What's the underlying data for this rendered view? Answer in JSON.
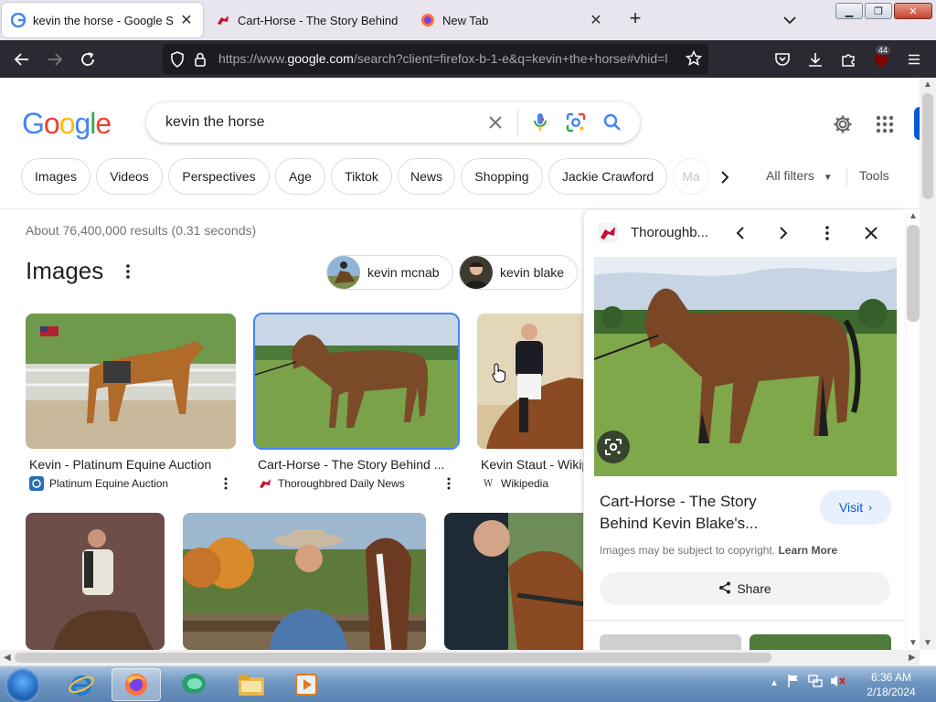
{
  "browser": {
    "tabs": [
      {
        "title": "kevin the horse - Google Search",
        "active": true
      },
      {
        "title": "Cart-Horse - The Story Behind K",
        "active": false
      },
      {
        "title": "New Tab",
        "active": false
      }
    ],
    "url_prefix": "https://www.",
    "url_domain": "google.com",
    "url_rest": "/search?client=firefox-b-1-e&q=kevin+the+horse#vhid=l",
    "extension_badge": "44"
  },
  "search": {
    "query": "kevin the horse",
    "logo": [
      "G",
      "o",
      "o",
      "g",
      "l",
      "e"
    ]
  },
  "chips": [
    "Images",
    "Videos",
    "Perspectives",
    "Age",
    "Tiktok",
    "News",
    "Shopping",
    "Jackie Crawford",
    "Ma"
  ],
  "filters": {
    "all_filters": "All filters",
    "tools": "Tools"
  },
  "results": {
    "stats": "About 76,400,000 results (0.31 seconds)",
    "images_heading": "Images",
    "related": [
      {
        "label": "kevin mcnab"
      },
      {
        "label": "kevin blake"
      }
    ],
    "cards": [
      {
        "caption": "Kevin - Platinum Equine Auction",
        "source": "Platinum Equine Auction"
      },
      {
        "caption": "Cart-Horse - The Story Behind ...",
        "source": "Thoroughbred Daily News"
      },
      {
        "caption": "Kevin Staut - Wikip",
        "source": "Wikipedia"
      }
    ]
  },
  "preview": {
    "site": "Thoroughb...",
    "title": "Cart-Horse - The Story Behind Kevin Blake's...",
    "visit": "Visit",
    "copyright": "Images may be subject to copyright.",
    "learn_more": "Learn More",
    "share": "Share"
  },
  "taskbar": {
    "time": "6:36 AM",
    "date": "2/18/2024"
  }
}
